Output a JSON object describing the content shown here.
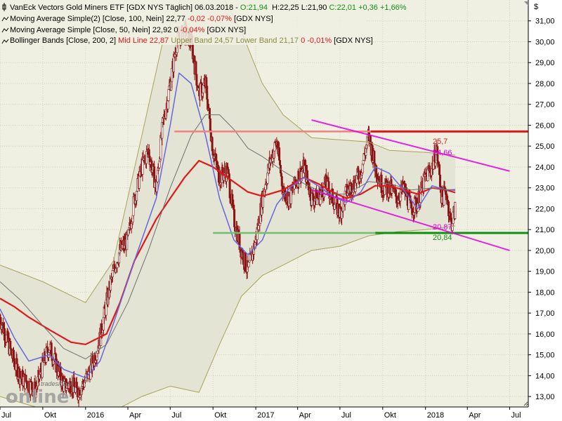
{
  "legend": {
    "l1": {
      "text": "VanEck Vectors Gold Miners ETF [GDX NYS  Täglich] 06.03.2018 - ",
      "o": "O:21,94",
      "h": "H:22,25",
      "l": "L:21,90",
      "c": "C:22,01",
      "chg": "+0,36",
      "pct": "+1,66%"
    },
    "l2": {
      "name": "Moving Average Simple(2) [Close, 100, Nein]",
      "value": "22,77",
      "chg": "-0,02",
      "pct": "-0,07%",
      "tail": "[GDX NYS]"
    },
    "l3": {
      "name": "Moving Average Simple [Close, 50, Nein]",
      "value": "22,92",
      "chg": "0",
      "pct": "-0,04%",
      "tail": "[GDX NYS]"
    },
    "l4": {
      "name": "Bollinger Bands [Close, 200, 2]",
      "mid": "Mid Line 22,87",
      "upper": "Upper Band 24,57",
      "lower": "Lower Band 21,17",
      "chg": "0",
      "pct": "-0,01%",
      "tail": "[GDX NYS]"
    }
  },
  "currency_symbol": "$",
  "logo": {
    "small": "tradesignal",
    "big": "online"
  },
  "annotations": {
    "top_red": "25,7",
    "top_magenta": "24,66",
    "low_magenta": "20,87",
    "low_green": "20,84"
  },
  "colors": {
    "background": "#f0f0e2",
    "band_fill": "#e4e4d4",
    "band_line": "#a8a35a",
    "ma100": "#e01818",
    "ma50": "#6666e0",
    "bb_mid": "#707070",
    "candle": "#8a1414",
    "resistance": "#e01818",
    "resistance_old": "#f08080",
    "support": "#109010",
    "support_old": "#70c070",
    "channel": "#e000e0",
    "channel_light": "#f090f0",
    "grid": "#d0d0c0"
  },
  "chart_data": {
    "type": "line",
    "ylim": [
      12.5,
      32.0
    ],
    "yticks": [
      13,
      14,
      15,
      16,
      17,
      18,
      19,
      20,
      21,
      22,
      23,
      24,
      25,
      26,
      27,
      28,
      29,
      30,
      31
    ],
    "ytick_labels": [
      "13,00",
      "14,00",
      "15,00",
      "16,00",
      "17,00",
      "18,00",
      "19,00",
      "20,00",
      "21,00",
      "22,00",
      "23,00",
      "24,00",
      "25,00",
      "26,00",
      "27,00",
      "28,00",
      "29,00",
      "30,00",
      "31,00"
    ],
    "x_range": [
      "2015-07-01",
      "2018-08-10"
    ],
    "xticks": [
      {
        "date": "2015-07-01",
        "label": "Jul"
      },
      {
        "date": "2015-10-01",
        "label": "Okt"
      },
      {
        "date": "2016-01-01",
        "label": "2016"
      },
      {
        "date": "2016-04-01",
        "label": "Apr"
      },
      {
        "date": "2016-07-01",
        "label": "Jul"
      },
      {
        "date": "2016-10-01",
        "label": "Okt"
      },
      {
        "date": "2017-01-01",
        "label": "2017"
      },
      {
        "date": "2017-04-01",
        "label": "Apr"
      },
      {
        "date": "2017-07-01",
        "label": "Jul"
      },
      {
        "date": "2017-10-01",
        "label": "Okt"
      },
      {
        "date": "2018-01-01",
        "label": "2018"
      },
      {
        "date": "2018-04-01",
        "label": "Apr"
      },
      {
        "date": "2018-07-01",
        "label": "Jul"
      }
    ],
    "series": [
      {
        "name": "Moving Average Simple(2) [Close, 100, Nein]",
        "color": "#e01818",
        "points": [
          [
            "2015-07-01",
            17.7
          ],
          [
            "2015-08-01",
            17.3
          ],
          [
            "2015-09-01",
            16.8
          ],
          [
            "2015-10-15",
            16.2
          ],
          [
            "2015-12-01",
            15.6
          ],
          [
            "2016-01-01",
            15.5
          ],
          [
            "2016-02-15",
            16.0
          ],
          [
            "2016-03-15",
            17.5
          ],
          [
            "2016-04-15",
            19.5
          ],
          [
            "2016-06-01",
            21.5
          ],
          [
            "2016-07-01",
            22.5
          ],
          [
            "2016-08-01",
            23.5
          ],
          [
            "2016-09-01",
            24.3
          ],
          [
            "2016-10-01",
            24.0
          ],
          [
            "2016-11-01",
            23.5
          ],
          [
            "2016-12-15",
            22.8
          ],
          [
            "2017-01-15",
            22.6
          ],
          [
            "2017-03-01",
            22.9
          ],
          [
            "2017-04-15",
            23.5
          ],
          [
            "2017-05-15",
            23.2
          ],
          [
            "2017-06-15",
            22.8
          ],
          [
            "2017-07-15",
            22.5
          ],
          [
            "2017-08-15",
            22.7
          ],
          [
            "2017-09-15",
            23.1
          ],
          [
            "2017-10-15",
            23.1
          ],
          [
            "2017-11-15",
            22.9
          ],
          [
            "2017-12-15",
            22.7
          ],
          [
            "2018-01-15",
            23.0
          ],
          [
            "2018-02-15",
            22.9
          ],
          [
            "2018-03-06",
            22.77
          ]
        ]
      },
      {
        "name": "Moving Average Simple [Close, 50, Nein]",
        "color": "#6666e0",
        "points": [
          [
            "2015-07-01",
            17.2
          ],
          [
            "2015-08-01",
            15.8
          ],
          [
            "2015-09-01",
            14.7
          ],
          [
            "2015-10-15",
            15.0
          ],
          [
            "2015-11-15",
            14.3
          ],
          [
            "2016-01-01",
            13.9
          ],
          [
            "2016-02-01",
            14.7
          ],
          [
            "2016-03-01",
            16.5
          ],
          [
            "2016-04-15",
            19.5
          ],
          [
            "2016-06-01",
            22.5
          ],
          [
            "2016-07-01",
            26.0
          ],
          [
            "2016-07-20",
            28.5
          ],
          [
            "2016-08-15",
            28.0
          ],
          [
            "2016-09-15",
            25.5
          ],
          [
            "2016-10-15",
            22.5
          ],
          [
            "2016-11-15",
            20.5
          ],
          [
            "2016-12-15",
            19.8
          ],
          [
            "2017-01-15",
            20.5
          ],
          [
            "2017-02-15",
            22.2
          ],
          [
            "2017-03-15",
            23.0
          ],
          [
            "2017-04-15",
            23.5
          ],
          [
            "2017-05-15",
            23.1
          ],
          [
            "2017-06-15",
            22.6
          ],
          [
            "2017-07-15",
            22.3
          ],
          [
            "2017-08-15",
            22.8
          ],
          [
            "2017-09-15",
            24.0
          ],
          [
            "2017-10-15",
            23.7
          ],
          [
            "2017-11-15",
            22.9
          ],
          [
            "2017-12-15",
            22.0
          ],
          [
            "2018-01-15",
            23.1
          ],
          [
            "2018-02-15",
            22.9
          ],
          [
            "2018-03-06",
            22.92
          ]
        ]
      },
      {
        "name": "Bollinger Bands Mid Line",
        "color": "#707070",
        "points": [
          [
            "2015-07-01",
            18.5
          ],
          [
            "2015-08-15",
            17.6
          ],
          [
            "2015-10-01",
            16.4
          ],
          [
            "2015-11-15",
            15.3
          ],
          [
            "2016-01-01",
            14.8
          ],
          [
            "2016-02-15",
            15.5
          ],
          [
            "2016-04-01",
            17.5
          ],
          [
            "2016-05-15",
            20.0
          ],
          [
            "2016-07-01",
            23.0
          ],
          [
            "2016-08-15",
            25.5
          ],
          [
            "2016-09-15",
            26.5
          ],
          [
            "2016-10-15",
            26.5
          ],
          [
            "2016-11-15",
            25.8
          ],
          [
            "2016-12-15",
            24.9
          ],
          [
            "2017-01-15",
            24.5
          ],
          [
            "2017-03-01",
            23.8
          ],
          [
            "2017-04-15",
            23.2
          ],
          [
            "2017-06-01",
            22.7
          ],
          [
            "2017-07-15",
            22.7
          ],
          [
            "2017-09-01",
            23.3
          ],
          [
            "2017-10-15",
            23.2
          ],
          [
            "2017-12-01",
            22.9
          ],
          [
            "2018-01-15",
            23.0
          ],
          [
            "2018-03-06",
            22.87
          ]
        ]
      },
      {
        "name": "Upper Band",
        "color": "#a8a35a",
        "points": [
          [
            "2015-07-01",
            19.3
          ],
          [
            "2015-10-01",
            18.5
          ],
          [
            "2016-01-01",
            17.5
          ],
          [
            "2016-03-01",
            19.5
          ],
          [
            "2016-05-01",
            25.5
          ],
          [
            "2016-06-15",
            30.0
          ],
          [
            "2016-08-01",
            32.5
          ],
          [
            "2016-09-01",
            33.0
          ],
          [
            "2016-10-15",
            32.5
          ],
          [
            "2016-12-01",
            30.5
          ],
          [
            "2017-01-15",
            28.0
          ],
          [
            "2017-03-01",
            26.5
          ],
          [
            "2017-05-01",
            25.4
          ],
          [
            "2017-07-01",
            25.3
          ],
          [
            "2017-09-01",
            25.2
          ],
          [
            "2017-10-15",
            24.8
          ],
          [
            "2018-01-01",
            24.7
          ],
          [
            "2018-03-06",
            24.57
          ]
        ]
      },
      {
        "name": "Lower Band",
        "color": "#a8a35a",
        "points": [
          [
            "2015-07-01",
            13.0
          ],
          [
            "2015-10-01",
            12.4
          ],
          [
            "2016-01-01",
            12.0
          ],
          [
            "2016-03-01",
            12.3
          ],
          [
            "2016-05-01",
            13.0
          ],
          [
            "2016-07-01",
            13.5
          ],
          [
            "2016-09-01",
            13.2
          ],
          [
            "2016-10-15",
            15.5
          ],
          [
            "2016-12-01",
            17.8
          ],
          [
            "2017-01-15",
            18.8
          ],
          [
            "2017-03-01",
            19.3
          ],
          [
            "2017-05-01",
            20.0
          ],
          [
            "2017-07-01",
            20.2
          ],
          [
            "2017-09-01",
            20.7
          ],
          [
            "2017-11-01",
            20.9
          ],
          [
            "2018-01-01",
            21.0
          ],
          [
            "2018-03-06",
            21.17
          ]
        ]
      }
    ],
    "price": {
      "name": "GDX Close (candles)",
      "points": [
        [
          "2015-07-01",
          16.8
        ],
        [
          "2015-07-15",
          15.8
        ],
        [
          "2015-08-01",
          14.6
        ],
        [
          "2015-08-15",
          13.9
        ],
        [
          "2015-09-01",
          13.6
        ],
        [
          "2015-09-15",
          13.3
        ],
        [
          "2015-10-01",
          14.5
        ],
        [
          "2015-10-15",
          15.4
        ],
        [
          "2015-11-01",
          14.4
        ],
        [
          "2015-11-15",
          13.5
        ],
        [
          "2015-12-01",
          13.6
        ],
        [
          "2015-12-15",
          13.2
        ],
        [
          "2016-01-01",
          13.8
        ],
        [
          "2016-01-15",
          14.5
        ],
        [
          "2016-02-01",
          15.8
        ],
        [
          "2016-02-15",
          17.5
        ],
        [
          "2016-03-01",
          19.0
        ],
        [
          "2016-03-15",
          20.0
        ],
        [
          "2016-04-01",
          20.5
        ],
        [
          "2016-04-15",
          22.5
        ],
        [
          "2016-05-01",
          24.0
        ],
        [
          "2016-05-15",
          24.8
        ],
        [
          "2016-06-01",
          23.0
        ],
        [
          "2016-06-15",
          26.0
        ],
        [
          "2016-07-01",
          28.0
        ],
        [
          "2016-07-15",
          30.0
        ],
        [
          "2016-08-01",
          30.5
        ],
        [
          "2016-08-15",
          30.0
        ],
        [
          "2016-09-01",
          27.5
        ],
        [
          "2016-09-15",
          28.0
        ],
        [
          "2016-10-01",
          24.8
        ],
        [
          "2016-10-15",
          23.5
        ],
        [
          "2016-11-01",
          23.8
        ],
        [
          "2016-11-15",
          21.5
        ],
        [
          "2016-12-01",
          20.0
        ],
        [
          "2016-12-15",
          19.0
        ],
        [
          "2017-01-01",
          20.5
        ],
        [
          "2017-01-15",
          22.5
        ],
        [
          "2017-02-01",
          24.3
        ],
        [
          "2017-02-15",
          25.2
        ],
        [
          "2017-03-01",
          22.8
        ],
        [
          "2017-03-15",
          22.5
        ],
        [
          "2017-04-01",
          23.5
        ],
        [
          "2017-04-15",
          24.0
        ],
        [
          "2017-05-01",
          22.5
        ],
        [
          "2017-05-15",
          22.5
        ],
        [
          "2017-06-01",
          23.2
        ],
        [
          "2017-06-15",
          22.5
        ],
        [
          "2017-07-01",
          21.8
        ],
        [
          "2017-07-15",
          22.8
        ],
        [
          "2017-08-01",
          23.2
        ],
        [
          "2017-08-15",
          23.8
        ],
        [
          "2017-09-01",
          25.5
        ],
        [
          "2017-09-15",
          24.0
        ],
        [
          "2017-10-01",
          23.0
        ],
        [
          "2017-10-15",
          23.0
        ],
        [
          "2017-11-01",
          22.5
        ],
        [
          "2017-11-15",
          23.0
        ],
        [
          "2017-12-01",
          22.0
        ],
        [
          "2017-12-15",
          22.3
        ],
        [
          "2018-01-01",
          23.5
        ],
        [
          "2018-01-15",
          24.0
        ],
        [
          "2018-01-25",
          24.8
        ],
        [
          "2018-02-05",
          22.5
        ],
        [
          "2018-02-15",
          22.8
        ],
        [
          "2018-02-25",
          21.2
        ],
        [
          "2018-03-06",
          22.01
        ]
      ]
    },
    "lines": [
      {
        "name": "Resistance (old)",
        "color": "#f08080",
        "from": [
          "2016-07-10",
          25.7
        ],
        "to": [
          "2017-09-05",
          25.7
        ]
      },
      {
        "name": "Resistance",
        "color": "#e01818",
        "from": [
          "2017-09-05",
          25.7
        ],
        "to": [
          "2018-08-10",
          25.7
        ]
      },
      {
        "name": "Support (old)",
        "color": "#70c070",
        "from": [
          "2016-10-01",
          20.84
        ],
        "to": [
          "2017-09-15",
          20.84
        ]
      },
      {
        "name": "Support",
        "color": "#109010",
        "from": [
          "2017-09-15",
          20.84
        ],
        "to": [
          "2018-08-10",
          20.84
        ]
      },
      {
        "name": "Channel upper",
        "color": "#e000e0",
        "from": [
          "2017-05-01",
          26.25
        ],
        "to": [
          "2018-07-01",
          23.8
        ]
      },
      {
        "name": "Channel lower",
        "color": "#e000e0",
        "from": [
          "2017-05-01",
          22.9
        ],
        "to": [
          "2018-07-01",
          20.0
        ]
      }
    ]
  }
}
